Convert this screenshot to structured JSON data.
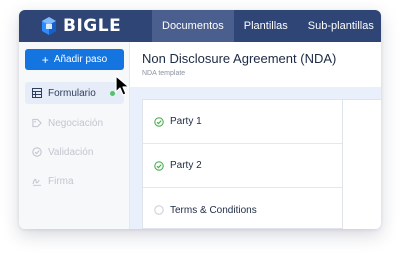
{
  "brand": {
    "name": "BIGLE",
    "logo_icon": "bigle-logo-icon"
  },
  "colors": {
    "topbar": "#2f4575",
    "nav_active": "#4a5f8d",
    "primary_button": "#1474e0",
    "status_dot": "#52c36b",
    "check": "#4caf50"
  },
  "nav": {
    "tabs": [
      "Documentos",
      "Plantillas",
      "Sub-plantillas"
    ],
    "active_index": 0
  },
  "sidebar": {
    "add_button": {
      "label": "Añadir paso",
      "icon": "plus-icon"
    },
    "items": [
      {
        "label": "Formulario",
        "icon": "table-icon",
        "active": true,
        "status": "green-dot"
      },
      {
        "label": "Negociación",
        "icon": "tag-icon",
        "active": false
      },
      {
        "label": "Validación",
        "icon": "check-circle-icon",
        "active": false
      },
      {
        "label": "Firma",
        "icon": "signature-icon",
        "active": false
      }
    ]
  },
  "document": {
    "title": "Non Disclosure Agreement (NDA)",
    "subtitle": "NDA template",
    "sections": [
      {
        "label": "Party 1",
        "completed": true
      },
      {
        "label": "Party 2",
        "completed": true
      },
      {
        "label": "Terms & Conditions",
        "completed": false
      }
    ]
  }
}
